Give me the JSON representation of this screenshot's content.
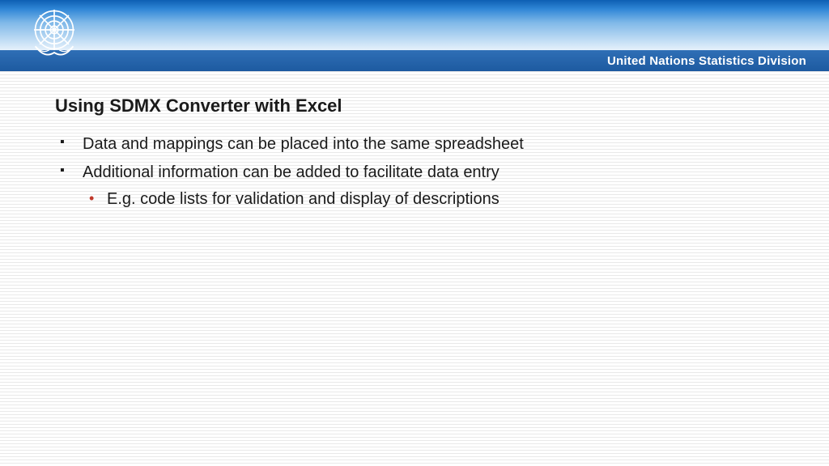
{
  "header": {
    "org_name": "United Nations Statistics Division",
    "logo_name": "un-emblem"
  },
  "slide": {
    "title": "Using SDMX Converter with Excel",
    "bullets": [
      {
        "text": "Data and mappings can be placed into the same spreadsheet",
        "sub": []
      },
      {
        "text": "Additional information can be added to facilitate data entry",
        "sub": [
          "E.g. code lists for validation and display of descriptions"
        ]
      }
    ]
  }
}
